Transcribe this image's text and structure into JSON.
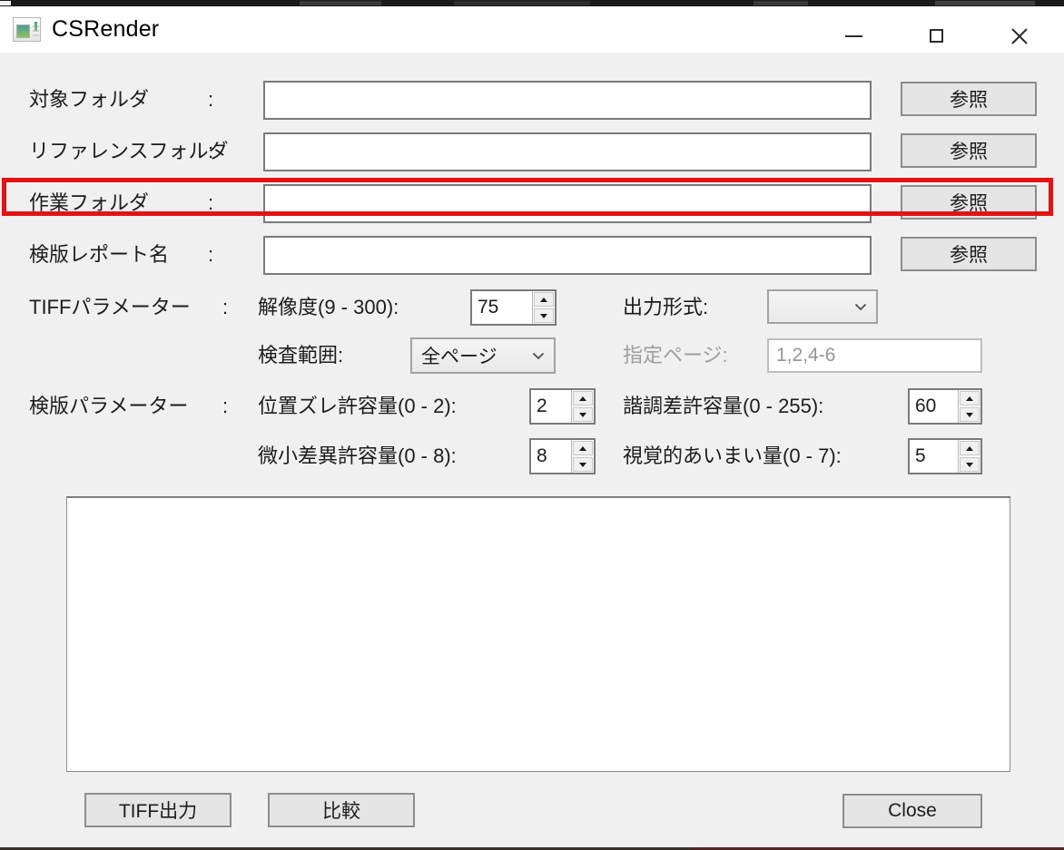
{
  "window": {
    "title": "CSRender"
  },
  "icons": {
    "app": "csrender-app-icon",
    "minimize": "minus",
    "maximize": "square-outline",
    "close": "x-cross",
    "combo_chevron": "chevron-down",
    "spin_up": "triangle-up",
    "spin_down": "triangle-down"
  },
  "form": {
    "colon": ":",
    "browse_label": "参照",
    "rows": [
      {
        "label": "対象フォルダ",
        "value": "",
        "highlighted": false
      },
      {
        "label": "リファレンスフォルダ",
        "value": "",
        "highlighted": false
      },
      {
        "label": "作業フォルダ",
        "value": "",
        "highlighted": true
      },
      {
        "label": "検版レポート名",
        "value": "",
        "highlighted": false
      }
    ]
  },
  "tiff": {
    "section_label": "TIFFパラメーター",
    "resolution_label": "解像度(9 - 300):",
    "resolution_value": "75",
    "output_format_label": "出力形式:",
    "output_format_value": "",
    "range_label": "検査範囲:",
    "range_value": "全ページ",
    "pages_label": "指定ページ:",
    "pages_value": "1,2,4-6"
  },
  "inspection": {
    "section_label": "検版パラメーター",
    "position_label": "位置ズレ許容量(0 - 2):",
    "position_value": "2",
    "tone_label": "諧調差許容量(0 - 255):",
    "tone_value": "60",
    "minor_label": "微小差異許容量(0 - 8):",
    "minor_value": "8",
    "visual_label": "視覚的あいまい量(0 - 7):",
    "visual_value": "5"
  },
  "log": {
    "value": ""
  },
  "footer": {
    "tiff_out_label": "TIFF出力",
    "compare_label": "比較",
    "close_label": "Close"
  },
  "colors": {
    "highlight_red": "#e31313",
    "window_bg": "#f0f0f0",
    "titlebar_bg": "#ffffff",
    "button_bg": "#e5e5e5",
    "button_border": "#8d8d8d",
    "input_border": "#7a7a7a",
    "disabled_text": "#9e9e9e"
  }
}
